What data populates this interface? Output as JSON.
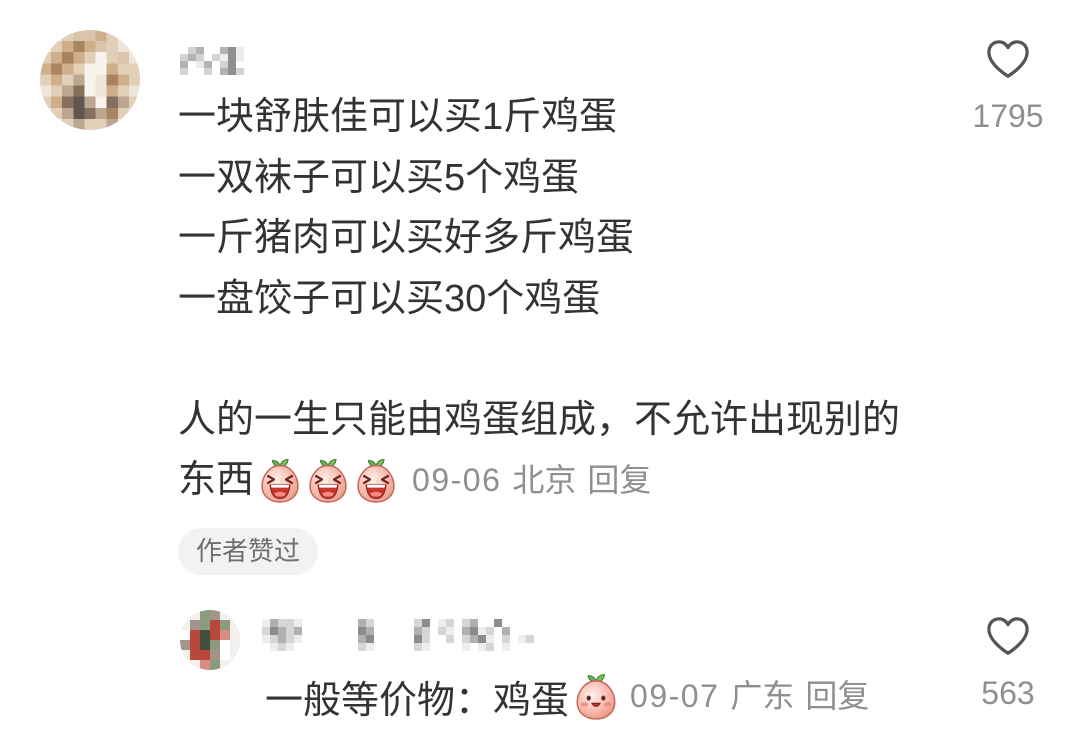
{
  "comment": {
    "text_lines": [
      "一块舒肤佳可以买1斤鸡蛋",
      "一双袜子可以买5个鸡蛋",
      "一斤猪肉可以买好多斤鸡蛋",
      "一盘饺子可以买30个鸡蛋",
      "人的一生只能由鸡蛋组成，不允许出现别的",
      "东西"
    ],
    "emojis": [
      "laughing-egg",
      "laughing-egg",
      "laughing-egg"
    ],
    "date": "09-06",
    "location": "北京",
    "reply_label": "回复",
    "like_count": "1795",
    "author_liked_badge": "作者赞过"
  },
  "reply": {
    "text": "一般等价物：鸡蛋",
    "emojis": [
      "smiling-egg"
    ],
    "date": "09-07",
    "location": "广东",
    "reply_label": "回复",
    "like_count": "563"
  },
  "icons": {
    "like": "heart-outline-icon",
    "avatar": "blurred-avatar",
    "username": "blurred-username"
  },
  "colors": {
    "text": "#333333",
    "meta_text": "#8f8f8f",
    "badge_bg": "#f2f2f2",
    "icon_stroke": "#555555"
  }
}
